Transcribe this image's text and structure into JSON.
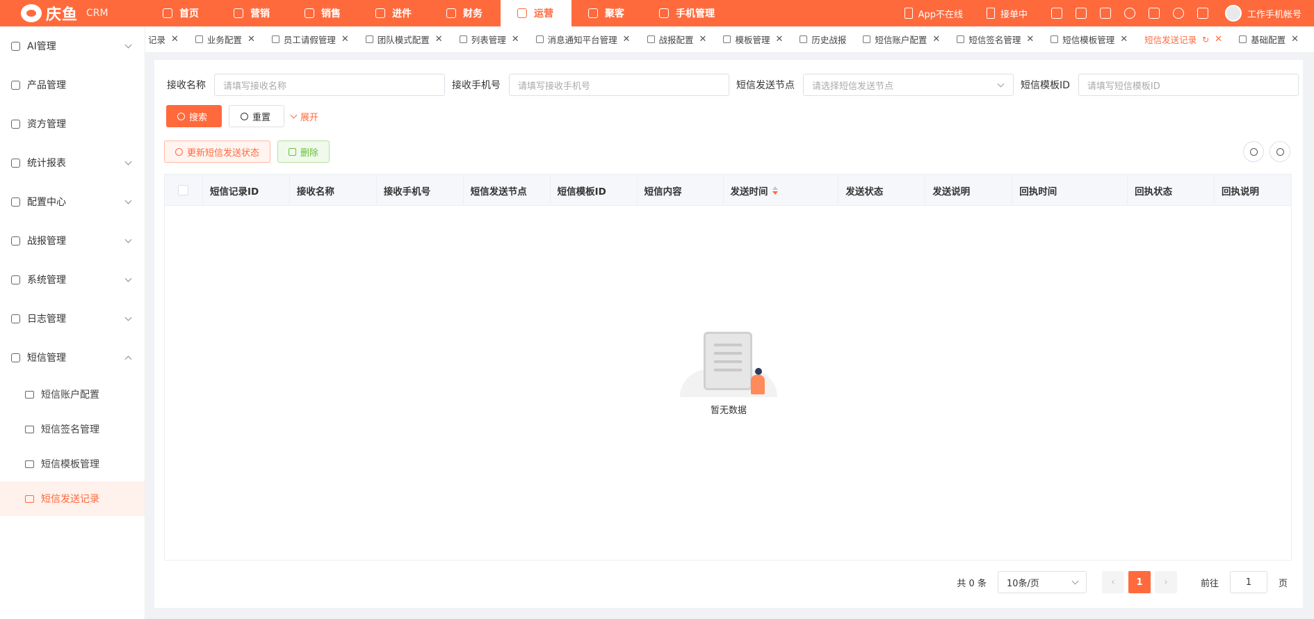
{
  "app": {
    "logo_text": "庆鱼",
    "logo_sub": "CRM"
  },
  "topnav": [
    {
      "label": "首页",
      "icon": "home-icon"
    },
    {
      "label": "营销",
      "icon": "target-icon"
    },
    {
      "label": "销售",
      "icon": "user-icon"
    },
    {
      "label": "进件",
      "icon": "document-icon"
    },
    {
      "label": "财务",
      "icon": "finance-icon"
    },
    {
      "label": "运营",
      "icon": "monitor-icon",
      "active": true
    },
    {
      "label": "聚客",
      "icon": "people-icon"
    },
    {
      "label": "手机管理",
      "icon": "phone-icon"
    }
  ],
  "topright": {
    "app_status": "App不在线",
    "order_status": "接单中",
    "user": "工作手机帐号"
  },
  "sidebar": {
    "items": [
      {
        "label": "AI管理",
        "icon": "ai-icon",
        "chevron": "down"
      },
      {
        "label": "产品管理",
        "icon": "box-icon"
      },
      {
        "label": "资方管理",
        "icon": "capital-icon"
      },
      {
        "label": "统计报表",
        "icon": "report-icon",
        "chevron": "down"
      },
      {
        "label": "配置中心",
        "icon": "config-icon",
        "chevron": "down"
      },
      {
        "label": "战报管理",
        "icon": "battle-report-icon",
        "chevron": "down"
      },
      {
        "label": "系统管理",
        "icon": "gear-icon",
        "chevron": "down"
      },
      {
        "label": "日志管理",
        "icon": "log-icon",
        "chevron": "down"
      },
      {
        "label": "短信管理",
        "icon": "mail-icon",
        "chevron": "up"
      }
    ],
    "subitems": [
      {
        "label": "短信账户配置",
        "icon": "sms-account-icon"
      },
      {
        "label": "短信签名管理",
        "icon": "signature-icon"
      },
      {
        "label": "短信模板管理",
        "icon": "template-icon"
      },
      {
        "label": "短信发送记录",
        "icon": "mail-icon",
        "active": true
      }
    ]
  },
  "tabs": [
    {
      "label": "记录",
      "icon": ""
    },
    {
      "label": "业务配置",
      "icon": "briefcase-icon"
    },
    {
      "label": "员工请假管理",
      "icon": "leave-icon"
    },
    {
      "label": "团队模式配置",
      "icon": "team-icon"
    },
    {
      "label": "列表管理",
      "icon": "list-icon"
    },
    {
      "label": "消息通知平台管理",
      "icon": "bell-icon"
    },
    {
      "label": "战报配置",
      "icon": "gear-icon"
    },
    {
      "label": "模板管理",
      "icon": "template-icon"
    },
    {
      "label": "历史战报",
      "icon": "history-icon"
    },
    {
      "label": "短信账户配置",
      "icon": "sms-account-icon"
    },
    {
      "label": "短信签名管理",
      "icon": "signature-icon"
    },
    {
      "label": "短信模板管理",
      "icon": "template-icon"
    },
    {
      "label": "短信发送记录",
      "icon": "",
      "active": true
    },
    {
      "label": "基础配置",
      "icon": "gear-icon"
    }
  ],
  "filters": {
    "recv_name_label": "接收名称",
    "recv_name_placeholder": "请填写接收名称",
    "recv_phone_label": "接收手机号",
    "recv_phone_placeholder": "请填写接收手机号",
    "node_label": "短信发送节点",
    "node_placeholder": "请选择短信发送节点",
    "template_label": "短信模板ID",
    "template_placeholder": "请填写短信模板ID"
  },
  "buttons": {
    "search": "搜索",
    "reset": "重置",
    "expand": "展开",
    "update_status": "更新短信发送状态",
    "delete": "删除"
  },
  "table": {
    "columns": [
      "短信记录ID",
      "接收名称",
      "接收手机号",
      "短信发送节点",
      "短信模板ID",
      "短信内容",
      "发送时间",
      "发送状态",
      "发送说明",
      "回执时间",
      "回执状态",
      "回执说明"
    ],
    "empty_text": "暂无数据"
  },
  "pagination": {
    "total": "共 0 条",
    "page_size": "10条/页",
    "current": "1",
    "goto_label": "前往",
    "goto_value": "1",
    "page_unit": "页",
    "prev": "‹",
    "next": "›"
  },
  "colors": {
    "accent": "#ff6a3d"
  }
}
